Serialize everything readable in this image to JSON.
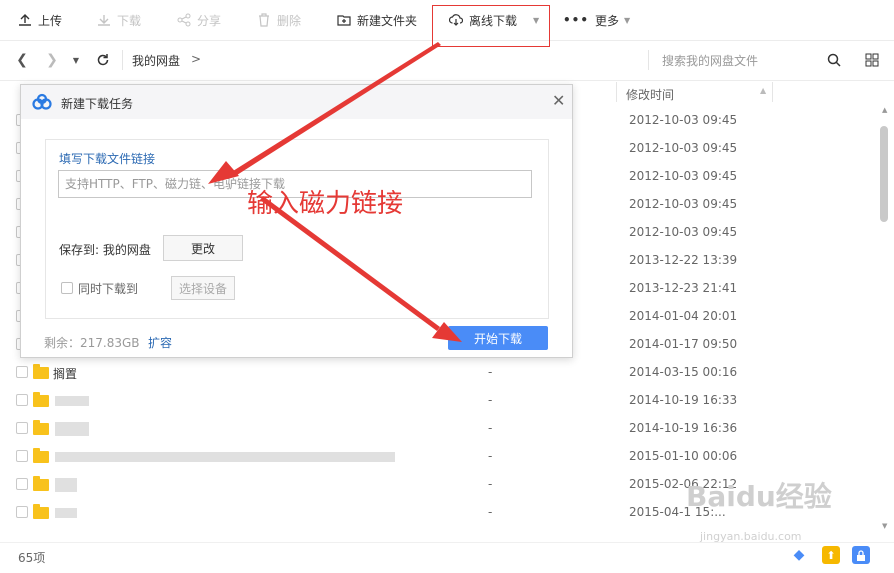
{
  "toolbar": {
    "upload": "上传",
    "download": "下载",
    "share": "分享",
    "delete": "删除",
    "new_folder": "新建文件夹",
    "offline_download": "离线下载",
    "more": "更多"
  },
  "nav": {
    "breadcrumb": "我的网盘",
    "breadcrumb_sep": ">",
    "search_placeholder": "搜索我的网盘文件"
  },
  "columns": {
    "modified": "修改时间"
  },
  "rows": [
    {
      "name": "",
      "size": "",
      "time": "2012-10-03 09:45"
    },
    {
      "name": "",
      "size": "",
      "time": "2012-10-03 09:45"
    },
    {
      "name": "",
      "size": "",
      "time": "2012-10-03 09:45"
    },
    {
      "name": "",
      "size": "",
      "time": "2012-10-03 09:45"
    },
    {
      "name": "",
      "size": "",
      "time": "2012-10-03 09:45"
    },
    {
      "name": "",
      "size": "",
      "time": "2013-12-22 13:39"
    },
    {
      "name": "",
      "size": "",
      "time": "2013-12-23 21:41"
    },
    {
      "name": "",
      "size": "",
      "time": "2014-01-04 20:01"
    },
    {
      "name": "",
      "size": "",
      "time": "2014-01-17 09:50"
    },
    {
      "name": "搁置",
      "size": "-",
      "time": "2014-03-15 00:16"
    },
    {
      "name": "",
      "size": "-",
      "time": "2014-10-19 16:33"
    },
    {
      "name": "",
      "size": "-",
      "time": "2014-10-19 16:36"
    },
    {
      "name": "",
      "size": "-",
      "time": "2015-01-10 00:06"
    },
    {
      "name": "",
      "size": "-",
      "time": "2015-02-06 22:12"
    },
    {
      "name": "",
      "size": "-",
      "time": "2015-04-1 15:..."
    }
  ],
  "footer": {
    "count": "65项"
  },
  "dialog": {
    "title": "新建下载任务",
    "link_label": "填写下载文件链接",
    "link_placeholder": "支持HTTP、FTP、磁力链、电驴链接下载",
    "save_to": "保存到: 我的网盘",
    "change_button": "更改",
    "also_download_to": "同时下载到",
    "select_device": "选择设备",
    "quota": "剩余：217.83GB",
    "expand": "扩容",
    "start_button": "开始下载"
  },
  "annotation": {
    "text": "输入磁力链接"
  },
  "watermark": {
    "logo": "Baidu经验",
    "url": "jingyan.baidu.com"
  },
  "colors": {
    "accent_blue": "#4a8cf7",
    "link_blue": "#2c6ab3",
    "annotation_red": "#e53935",
    "folder_yellow": "#f8c21c"
  }
}
